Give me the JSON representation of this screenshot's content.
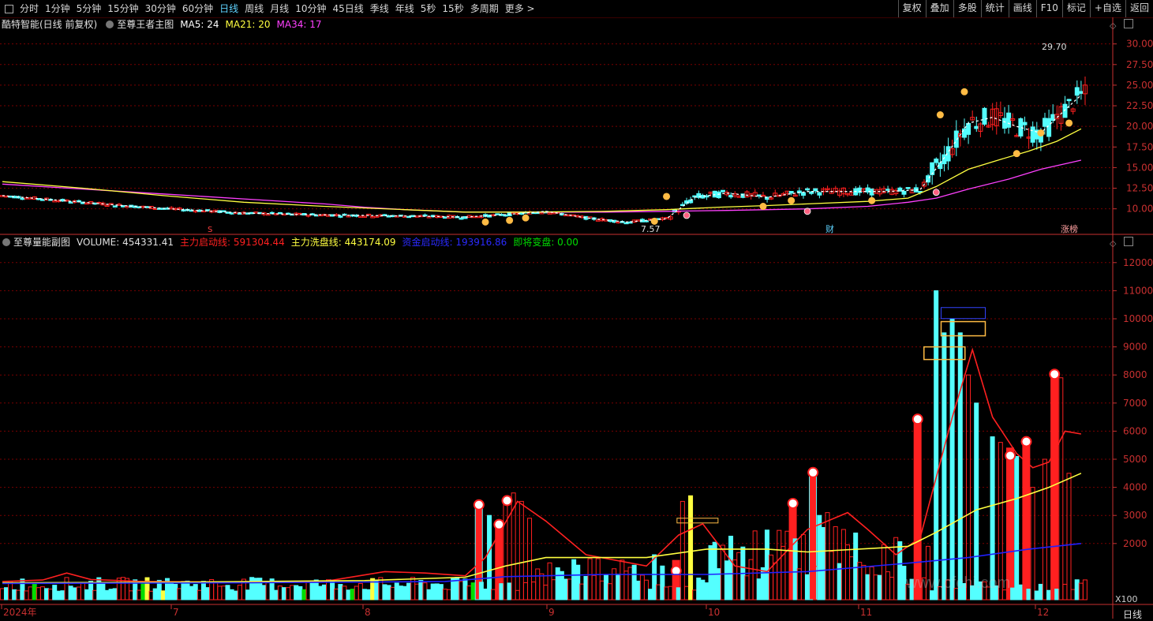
{
  "toolbar": {
    "periods": [
      "分时",
      "1分钟",
      "5分钟",
      "15分钟",
      "30分钟",
      "60分钟",
      "日线",
      "周线",
      "月线",
      "10分钟",
      "45日线",
      "季线",
      "年线",
      "5秒",
      "15秒",
      "多周期",
      "更多 >"
    ],
    "active_period": "日线",
    "actions": [
      "复权",
      "叠加",
      "多股",
      "统计",
      "画线",
      "F10",
      "标记",
      "+自选",
      "返回"
    ]
  },
  "main_legend": {
    "title": "酷特智能(日线 前复权)",
    "indicator": "至尊王者主图",
    "ma5": "MA5: 24",
    "ma21": "MA21: 20",
    "ma34": "MA34: 17"
  },
  "sub_legend": {
    "indicator": "至尊量能副图",
    "volume": "VOLUME: 454331.41",
    "main_start": "主力启动线: 591304.44",
    "main_wash": "主力洗盘线: 443174.09",
    "capital_start": "资金启动线: 193916.86",
    "about_change": "即将变盘: 0.00"
  },
  "colors": {
    "up": "#ff2020",
    "down": "#54ffff",
    "ma5": "#ffffff",
    "ma21": "#ffff40",
    "ma34": "#ff40ff",
    "grid": "#7a0000",
    "axis": "#c83030",
    "blue": "#2020ff",
    "green": "#00dd00"
  },
  "chart_data": [
    {
      "type": "line",
      "name": "price",
      "y_ticks": [
        "30.00",
        "27.50",
        "25.00",
        "22.50",
        "20.00",
        "17.50",
        "15.00",
        "12.50",
        "10.00"
      ],
      "ylim": [
        7.0,
        31.5
      ],
      "annotations": {
        "high": "29.70",
        "low": "7.57",
        "badge_left": "财",
        "badge_right": "涨榜",
        "event_mark": "S"
      },
      "ma34": [
        [
          0,
          13.0
        ],
        [
          20,
          12.4
        ],
        [
          40,
          11.8
        ],
        [
          60,
          11.2
        ],
        [
          80,
          10.6
        ],
        [
          90,
          10.2
        ],
        [
          100,
          9.9
        ],
        [
          115,
          9.6
        ],
        [
          130,
          9.6
        ],
        [
          150,
          9.6
        ],
        [
          165,
          9.7
        ],
        [
          180,
          9.8
        ],
        [
          190,
          9.9
        ],
        [
          200,
          10.0
        ],
        [
          215,
          10.3
        ],
        [
          225,
          10.8
        ],
        [
          232,
          11.3
        ],
        [
          240,
          12.4
        ],
        [
          250,
          13.6
        ],
        [
          258,
          14.8
        ],
        [
          268,
          15.9
        ]
      ],
      "ma21": [
        [
          0,
          13.3
        ],
        [
          20,
          12.5
        ],
        [
          40,
          11.6
        ],
        [
          60,
          10.8
        ],
        [
          80,
          10.3
        ],
        [
          100,
          9.9
        ],
        [
          115,
          9.6
        ],
        [
          130,
          9.6
        ],
        [
          150,
          9.7
        ],
        [
          165,
          9.9
        ],
        [
          178,
          10.2
        ],
        [
          190,
          10.4
        ],
        [
          200,
          10.6
        ],
        [
          215,
          10.9
        ],
        [
          225,
          11.3
        ],
        [
          232,
          12.7
        ],
        [
          240,
          14.8
        ],
        [
          248,
          16.0
        ],
        [
          255,
          17.0
        ],
        [
          262,
          18.2
        ],
        [
          268,
          19.7
        ]
      ],
      "ma5": [
        [
          0,
          11.6
        ],
        [
          15,
          11.0
        ],
        [
          30,
          10.4
        ],
        [
          45,
          9.9
        ],
        [
          60,
          9.5
        ],
        [
          75,
          9.3
        ],
        [
          90,
          9.2
        ],
        [
          105,
          9.1
        ],
        [
          115,
          9.0
        ],
        [
          125,
          9.3
        ],
        [
          135,
          9.7
        ],
        [
          145,
          8.9
        ],
        [
          155,
          8.4
        ],
        [
          165,
          8.8
        ],
        [
          172,
          11.4
        ],
        [
          180,
          11.9
        ],
        [
          190,
          11.4
        ],
        [
          200,
          12.1
        ],
        [
          210,
          12.1
        ],
        [
          220,
          12.1
        ],
        [
          228,
          12.3
        ],
        [
          234,
          16.2
        ],
        [
          240,
          20.4
        ],
        [
          246,
          21.1
        ],
        [
          252,
          20.0
        ],
        [
          258,
          19.2
        ],
        [
          264,
          22.0
        ],
        [
          268,
          23.8
        ]
      ]
    },
    {
      "type": "bar",
      "name": "volume",
      "y_ticks": [
        "12000",
        "11000",
        "10000",
        "9000",
        "8000",
        "7000",
        "6000",
        "5000",
        "4000",
        "3000",
        "2000"
      ],
      "ylim": [
        0,
        12500
      ],
      "scale_label": "X100"
    }
  ],
  "x_axis": [
    "2024年",
    "7",
    "8",
    "9",
    "10",
    "11",
    "12"
  ],
  "period_footer": "日线",
  "watermark": "www.cfchi.com"
}
